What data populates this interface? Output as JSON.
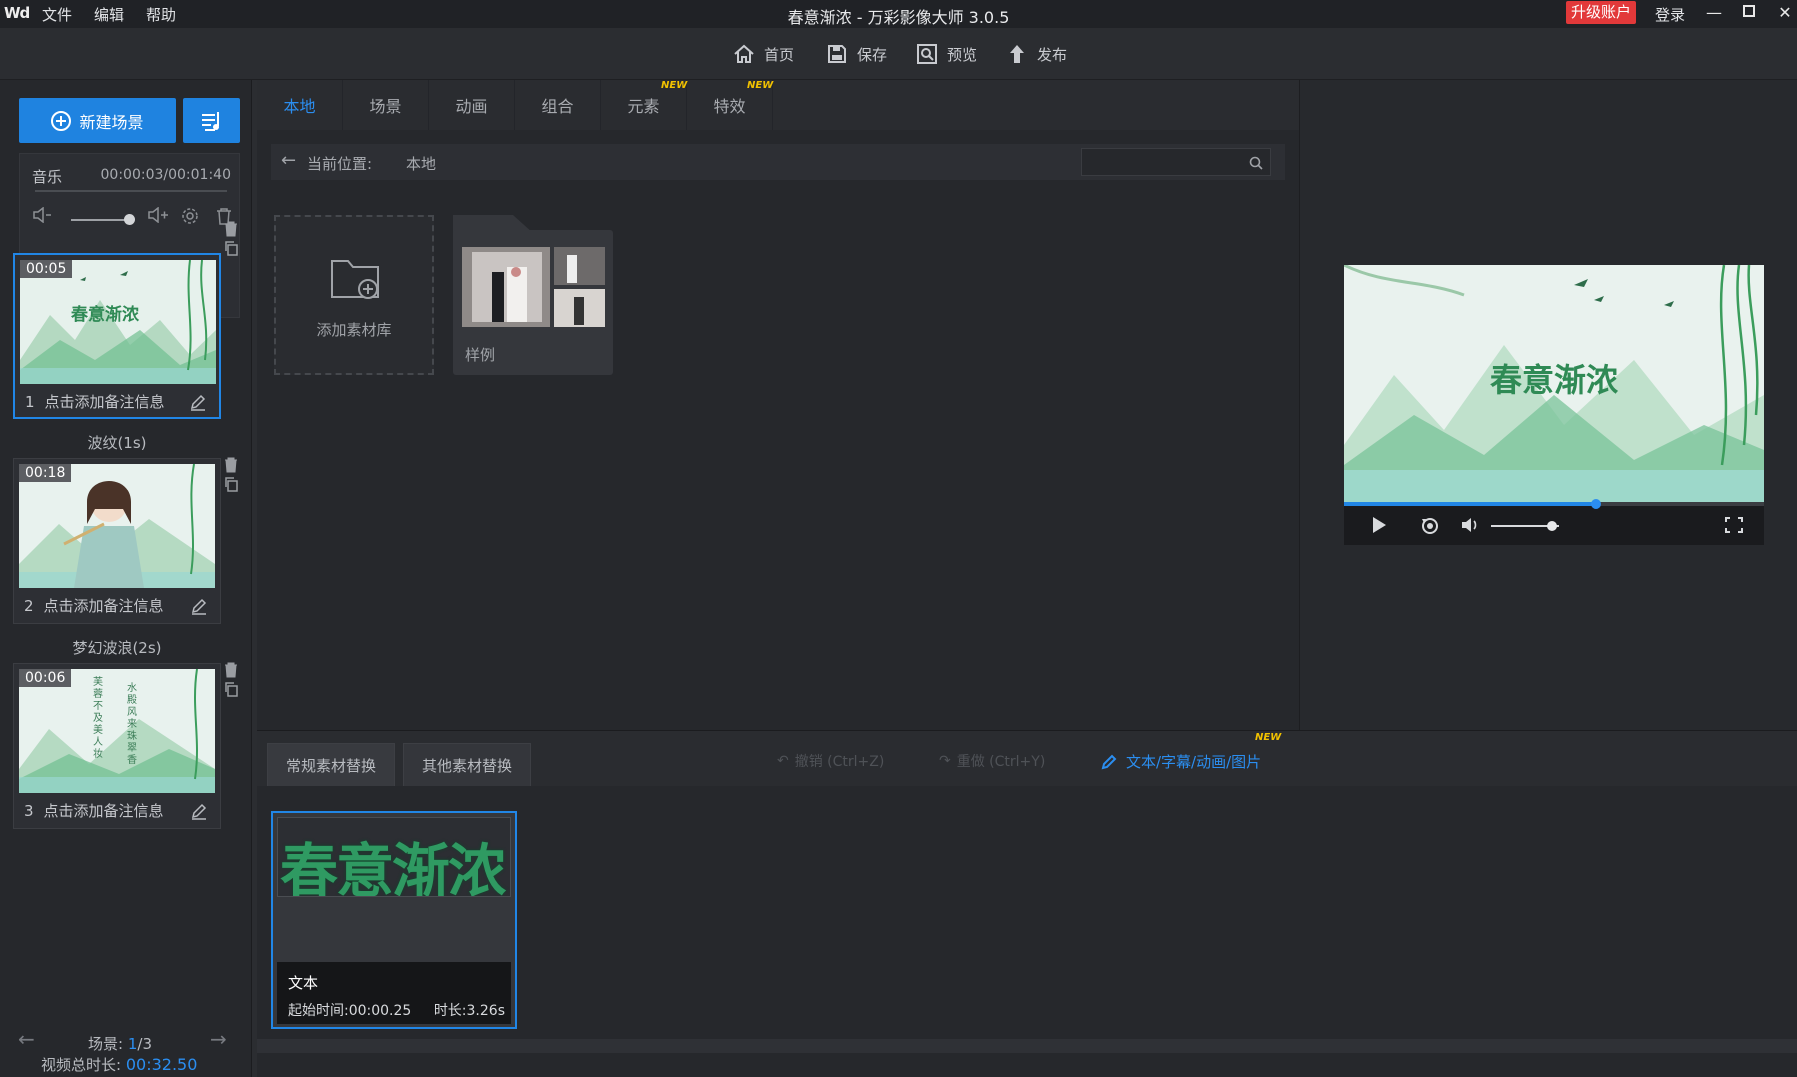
{
  "titlebar": {
    "logo": "Wd",
    "menu": [
      "文件",
      "编辑",
      "帮助"
    ],
    "title": "春意渐浓 - 万彩影像大师 3.0.5",
    "upgrade": "升级账户",
    "login": "登录"
  },
  "toolbar": {
    "home": "首页",
    "save": "保存",
    "preview": "预览",
    "publish": "发布"
  },
  "left": {
    "new_scene": "新建场景",
    "music_label": "音乐",
    "music_time": "00:00:03/00:01:40",
    "volume_level": 0.85,
    "scenes": [
      {
        "num": "1",
        "duration": "00:05",
        "note": "点击添加备注信息",
        "title_text": "春意渐浓"
      },
      {
        "num": "2",
        "duration": "00:18",
        "note": "点击添加备注信息"
      },
      {
        "num": "3",
        "duration": "00:06",
        "note": "点击添加备注信息",
        "vertical_text": [
          "芙蓉不及美人妆",
          "水殿风来珠翠香"
        ]
      }
    ],
    "transitions": [
      "波纹(1s)",
      "梦幻波浪(2s)"
    ],
    "scene_count_label": "场景:",
    "scene_current": "1",
    "scene_total": "/3",
    "total_duration_label": "视频总时长:",
    "total_duration": "00:32.50"
  },
  "material": {
    "tabs": [
      {
        "label": "本地",
        "new": false
      },
      {
        "label": "场景",
        "new": false
      },
      {
        "label": "动画",
        "new": false
      },
      {
        "label": "组合",
        "new": false
      },
      {
        "label": "元素",
        "new": true
      },
      {
        "label": "特效",
        "new": true
      }
    ],
    "new_badge": "NEW",
    "path_label": "当前位置:",
    "path_value": "本地",
    "search_placeholder": "",
    "add_library": "添加素材库",
    "sample_folder": "样例"
  },
  "preview": {
    "title_text": "春意渐浓",
    "progress": 0.6,
    "volume_level": 0.9
  },
  "bottom": {
    "tabs": [
      "常规素材替换",
      "其他素材替换"
    ],
    "undo": "撤销 (Ctrl+Z)",
    "redo": "重做 (Ctrl+Y)",
    "edit_link": "文本/字幕/动画/图片",
    "card": {
      "preview_text": "春意渐浓",
      "type": "文本",
      "start": "起始时间:00:00.25",
      "duration": "时长:3.26s"
    }
  },
  "colors": {
    "accent": "#1f83e0",
    "upgrade": "#e2393a",
    "new_badge": "#f2c200",
    "title_green": "#2f9a62"
  }
}
